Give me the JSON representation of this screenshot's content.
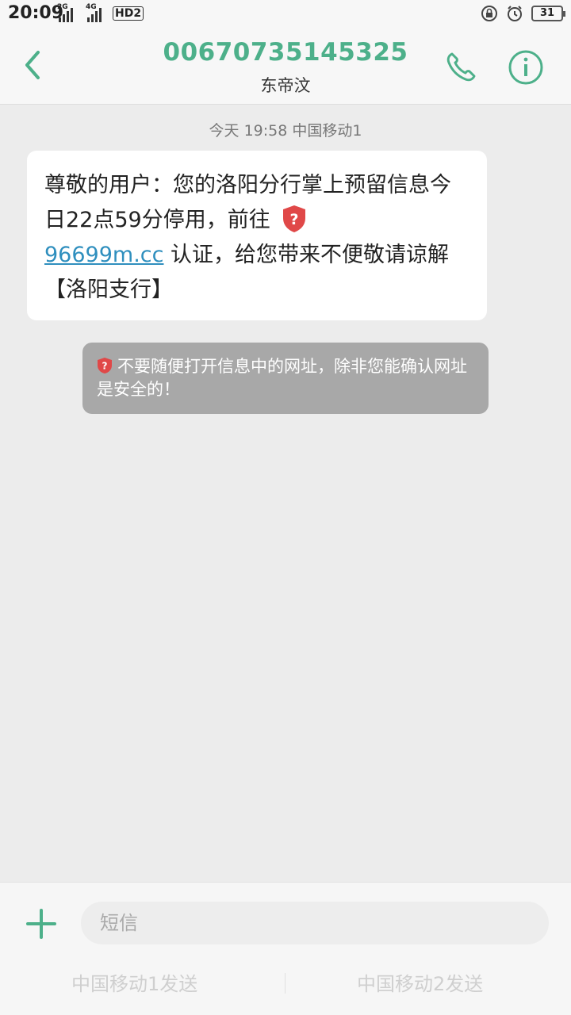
{
  "status_bar": {
    "time": "20:09",
    "network1": "2G",
    "network2": "4G",
    "hd": "HD2",
    "battery": "31"
  },
  "header": {
    "title": "00670735145325",
    "subtitle": "东帝汶"
  },
  "conversation": {
    "timestamp": "今天 19:58  中国移动1",
    "message": {
      "text_part1": "尊敬的用户：您的洛阳分行掌上预留信息今日22点59分停用，前往",
      "link": "96699m.cc",
      "text_part2": " 认证，给您带来不便敬请谅解【洛阳支行】"
    },
    "warning": "不要随便打开信息中的网址，除非您能确认网址是安全的！"
  },
  "composer": {
    "placeholder": "短信",
    "send1": "中国移动1发送",
    "send2": "中国移动2发送"
  },
  "colors": {
    "accent": "#4db08a",
    "link": "#2f8fbe",
    "shield": "#e04848",
    "warning_bg": "#a8a8a8"
  },
  "icons": [
    "back-arrow-icon",
    "phone-icon",
    "info-icon",
    "shield-question-icon",
    "plus-icon"
  ]
}
